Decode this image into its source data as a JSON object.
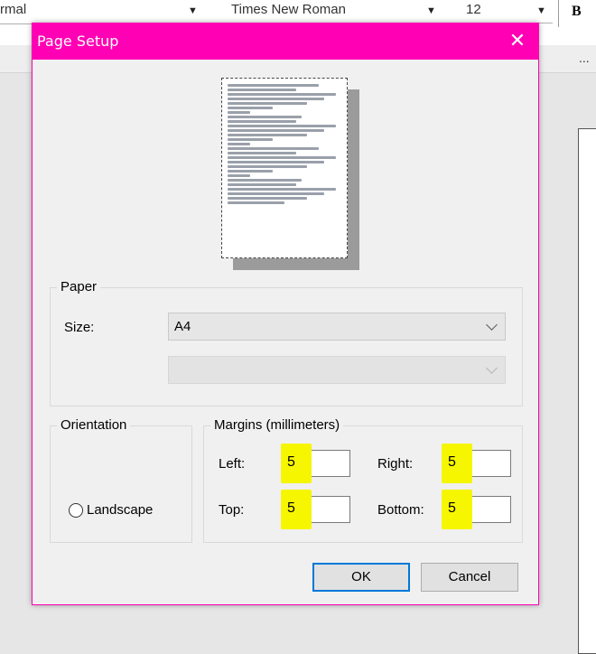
{
  "app": {
    "style_combo": "rmal",
    "font_combo": "Times New Roman",
    "size_combo": "12",
    "bold_label": "B",
    "more_label": "..."
  },
  "dialog": {
    "title": "Page Setup",
    "close_glyph": "✕",
    "titlebar_color": "#ff00b4"
  },
  "paper": {
    "group_label": "Paper",
    "size_label": "Size:",
    "size_value": "A4",
    "source_value": ""
  },
  "orientation": {
    "group_label": "Orientation",
    "landscape_label": "Landscape"
  },
  "margins": {
    "group_label": "Margins (millimeters)",
    "left_label": "Left:",
    "left_value": "5",
    "right_label": "Right:",
    "right_value": "5",
    "top_label": "Top:",
    "top_value": "5",
    "bottom_label": "Bottom:",
    "bottom_value": "5",
    "highlight_color": "#f6f600"
  },
  "buttons": {
    "ok": "OK",
    "cancel": "Cancel"
  }
}
